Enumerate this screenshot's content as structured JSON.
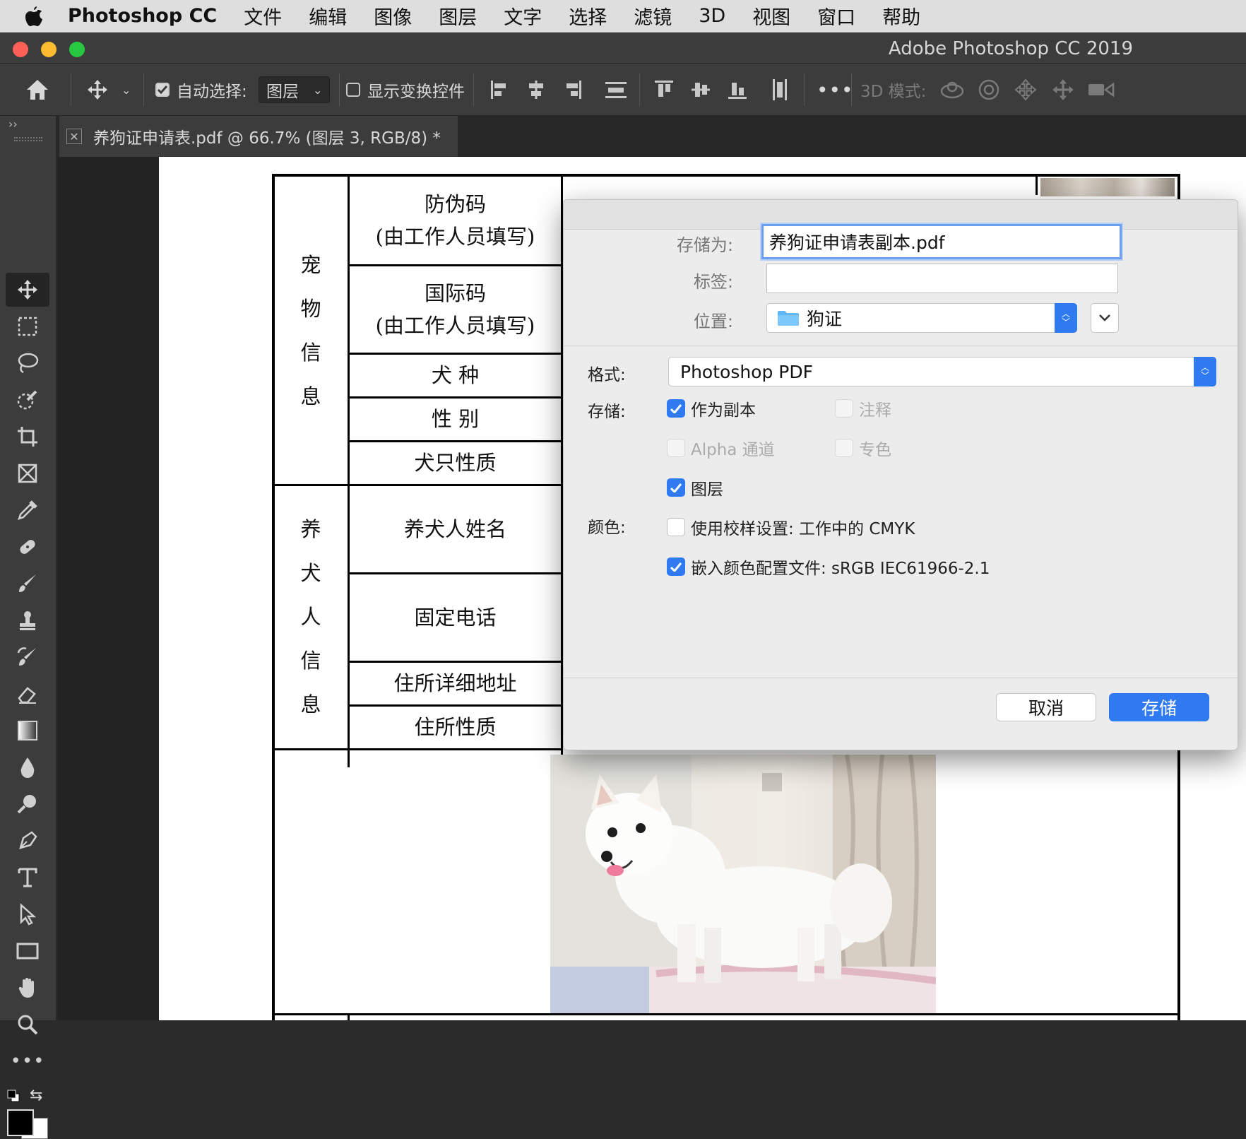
{
  "menubar": {
    "app": "Photoshop CC",
    "items": [
      "文件",
      "编辑",
      "图像",
      "图层",
      "文字",
      "选择",
      "滤镜",
      "3D",
      "视图",
      "窗口",
      "帮助"
    ]
  },
  "window": {
    "title": "Adobe Photoshop CC 2019"
  },
  "options_bar": {
    "auto_select_label": "自动选择:",
    "auto_select_value": "图层",
    "show_transform_label": "显示变换控件",
    "mode_3d_label": "3D 模式:"
  },
  "tab": {
    "label": "养狗证申请表.pdf @ 66.7% (图层 3, RGB/8) *"
  },
  "document": {
    "section_pet": [
      "宠",
      "物",
      "信",
      "息"
    ],
    "section_owner": [
      "养",
      "犬",
      "人",
      "信",
      "息"
    ],
    "rows": {
      "anti_fake": [
        "防伪码",
        "(由工作人员填写)"
      ],
      "intl_code": [
        "国际码",
        "(由工作人员填写)"
      ],
      "breed": "犬 种",
      "sex": "性 别",
      "nature": "犬只性质",
      "owner_name": "养犬人姓名",
      "phone": "固定电话",
      "address": "住所详细地址",
      "address_nature": "住所性质"
    }
  },
  "dialog": {
    "save_as_label": "存储为:",
    "save_as_value": "养狗证申请表副本.pdf",
    "tags_label": "标签:",
    "tags_value": "",
    "location_label": "位置:",
    "location_value": "狗证",
    "format_label": "格式:",
    "format_value": "Photoshop PDF",
    "save_label": "存储:",
    "color_label": "颜色:",
    "options": {
      "as_copy": "作为副本",
      "notes": "注释",
      "alpha": "Alpha 通道",
      "spot": "专色",
      "layers": "图层",
      "proof": "使用校样设置: 工作中的 CMYK",
      "icc": "嵌入颜色配置文件: sRGB IEC61966-2.1"
    },
    "cancel": "取消",
    "save": "存储"
  },
  "colors": {
    "accent": "#2f7af1",
    "close": "#fe5f57",
    "minimize": "#febc2e",
    "zoom": "#28c840"
  }
}
